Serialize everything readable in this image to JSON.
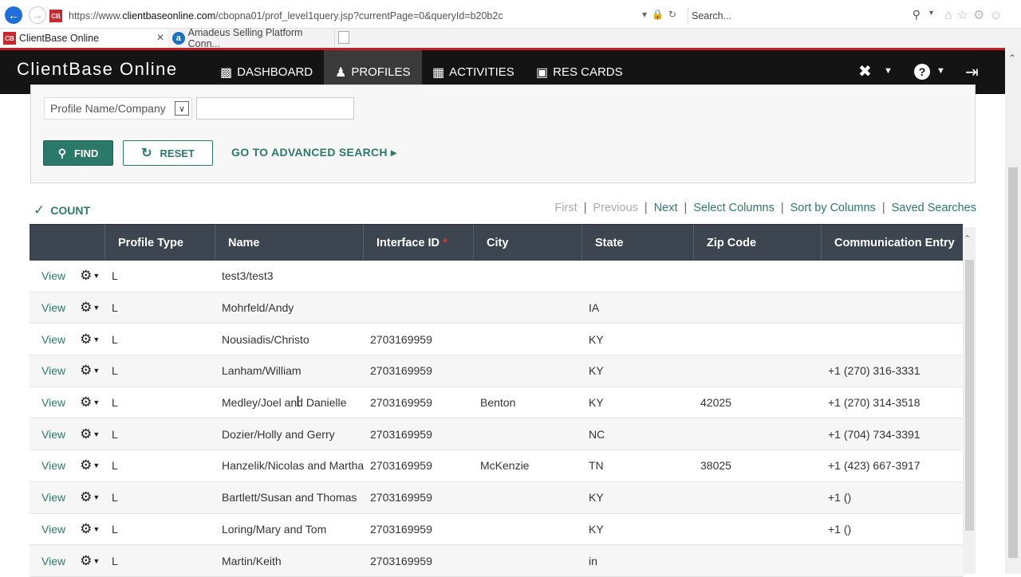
{
  "browser": {
    "url_prefix": "https://www.",
    "url_host": "clientbaseonline.com",
    "url_path": "/cbopna01/prof_level1query.jsp?currentPage=0&queryId=b20b2c",
    "search_placeholder": "Search...",
    "tabs": [
      {
        "label": "ClientBase Online",
        "favicon": "CB"
      },
      {
        "label": "Amadeus Selling Platform Conn...",
        "favicon": "a"
      }
    ]
  },
  "app": {
    "title": "ClientBase Online",
    "nav": [
      {
        "label": "DASHBOARD",
        "icon": "bar-chart-icon"
      },
      {
        "label": "PROFILES",
        "icon": "user-icon"
      },
      {
        "label": "ACTIVITIES",
        "icon": "calendar-icon"
      },
      {
        "label": "RES CARDS",
        "icon": "briefcase-icon"
      }
    ]
  },
  "search": {
    "field_label": "Profile Name/Company",
    "field_value": "",
    "find_label": "FIND",
    "reset_label": "RESET",
    "advanced_label": "GO TO ADVANCED SEARCH"
  },
  "results": {
    "count_label": "COUNT",
    "pager": {
      "first": "First",
      "previous": "Previous",
      "next": "Next",
      "select_columns": "Select Columns",
      "sort_by_columns": "Sort by Columns",
      "saved_searches": "Saved Searches"
    },
    "columns": [
      "",
      "Profile Type",
      "Name",
      "Interface ID",
      "City",
      "State",
      "Zip Code",
      "Communication Entry"
    ],
    "view_label": "View",
    "rows": [
      {
        "type": "L",
        "name": "test3/test3",
        "interface_id": "",
        "city": "",
        "state": "",
        "zip": "",
        "comm": ""
      },
      {
        "type": "L",
        "name": "Mohrfeld/Andy",
        "interface_id": "",
        "city": "",
        "state": "IA",
        "zip": "",
        "comm": ""
      },
      {
        "type": "L",
        "name": "Nousiadis/Christo",
        "interface_id": "2703169959",
        "city": "",
        "state": "KY",
        "zip": "",
        "comm": ""
      },
      {
        "type": "L",
        "name": "Lanham/William",
        "interface_id": "2703169959",
        "city": "",
        "state": "KY",
        "zip": "",
        "comm": "+1 (270) 316-3331"
      },
      {
        "type": "L",
        "name": "Medley/Joel and Danielle",
        "interface_id": "2703169959",
        "city": "Benton",
        "state": "KY",
        "zip": "42025",
        "comm": "+1 (270) 314-3518"
      },
      {
        "type": "L",
        "name": "Dozier/Holly and Gerry",
        "interface_id": "2703169959",
        "city": "",
        "state": "NC",
        "zip": "",
        "comm": "+1 (704) 734-3391"
      },
      {
        "type": "L",
        "name": "Hanzelik/Nicolas and Martha",
        "interface_id": "2703169959",
        "city": "McKenzie",
        "state": "TN",
        "zip": "38025",
        "comm": "+1 (423) 667-3917"
      },
      {
        "type": "L",
        "name": "Bartlett/Susan and Thomas",
        "interface_id": "2703169959",
        "city": "",
        "state": "KY",
        "zip": "",
        "comm": "+1 ()"
      },
      {
        "type": "L",
        "name": "Loring/Mary and Tom",
        "interface_id": "2703169959",
        "city": "",
        "state": "KY",
        "zip": "",
        "comm": "+1 ()"
      },
      {
        "type": "L",
        "name": "Martin/Keith",
        "interface_id": "2703169959",
        "city": "",
        "state": "in",
        "zip": "",
        "comm": ""
      }
    ]
  }
}
